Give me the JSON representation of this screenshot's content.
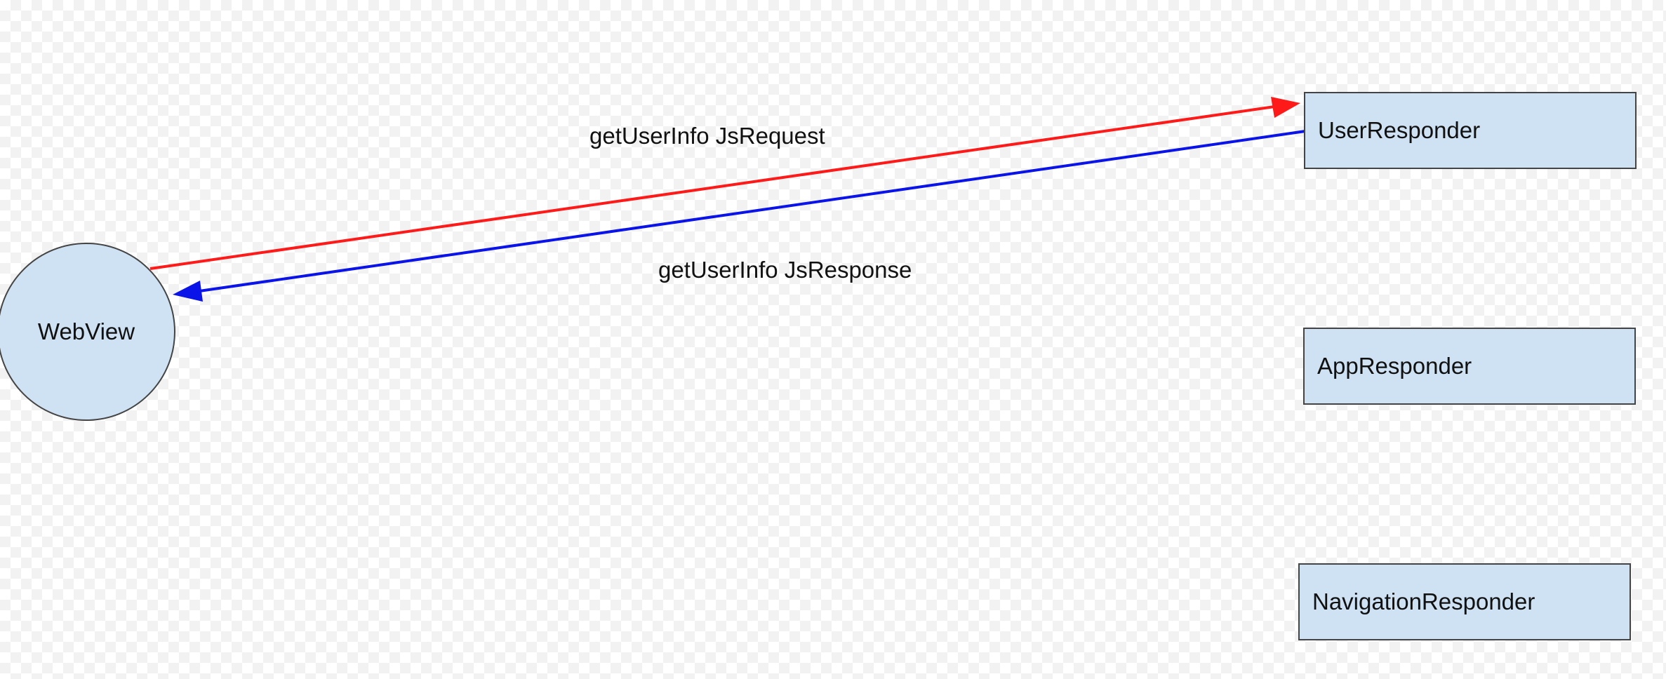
{
  "diagram": {
    "nodes": {
      "webview": {
        "label": "WebView",
        "shape": "circle"
      },
      "user_responder": {
        "label": "UserResponder",
        "shape": "rectangle"
      },
      "app_responder": {
        "label": "AppResponder",
        "shape": "rectangle"
      },
      "navigation_responder": {
        "label": "NavigationResponder",
        "shape": "rectangle"
      }
    },
    "edges": [
      {
        "from": "WebView",
        "to": "UserResponder",
        "label": "getUserInfo JsRequest",
        "color": "#ff1a1a"
      },
      {
        "from": "UserResponder",
        "to": "WebView",
        "label": "getUserInfo JsResponse",
        "color": "#0a14e8"
      }
    ],
    "colors": {
      "node_fill": "#cfe2f3",
      "node_border": "#444444",
      "request_arrow": "#ff1a1a",
      "response_arrow": "#0a14e8"
    }
  }
}
